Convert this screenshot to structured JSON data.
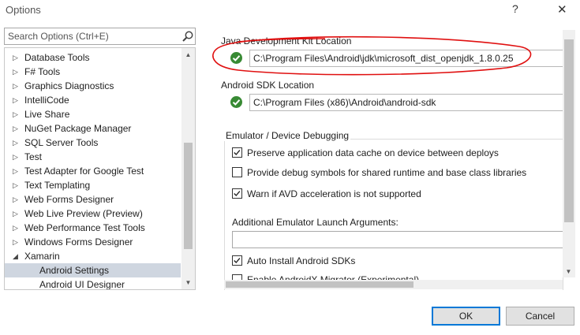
{
  "window": {
    "title": "Options",
    "help": "?",
    "close": "✕"
  },
  "search": {
    "placeholder": "Search Options (Ctrl+E)"
  },
  "tree": {
    "items": [
      {
        "label": "Database Tools",
        "expanded": false
      },
      {
        "label": "F# Tools",
        "expanded": false
      },
      {
        "label": "Graphics Diagnostics",
        "expanded": false
      },
      {
        "label": "IntelliCode",
        "expanded": false
      },
      {
        "label": "Live Share",
        "expanded": false
      },
      {
        "label": "NuGet Package Manager",
        "expanded": false
      },
      {
        "label": "SQL Server Tools",
        "expanded": false
      },
      {
        "label": "Test",
        "expanded": false
      },
      {
        "label": "Test Adapter for Google Test",
        "expanded": false
      },
      {
        "label": "Text Templating",
        "expanded": false
      },
      {
        "label": "Web Forms Designer",
        "expanded": false
      },
      {
        "label": "Web Live Preview (Preview)",
        "expanded": false
      },
      {
        "label": "Web Performance Test Tools",
        "expanded": false
      },
      {
        "label": "Windows Forms Designer",
        "expanded": false
      },
      {
        "label": "Xamarin",
        "expanded": true
      },
      {
        "label": "Android Settings",
        "child": true,
        "selected": true
      },
      {
        "label": "Android UI Designer",
        "child": true
      }
    ]
  },
  "settings": {
    "jdk": {
      "label": "Java Development Kit Location",
      "path": "C:\\Program Files\\Android\\jdk\\microsoft_dist_openjdk_1.8.0.25"
    },
    "sdk": {
      "label": "Android SDK Location",
      "path": "C:\\Program Files (x86)\\Android\\android-sdk"
    },
    "emulator": {
      "title": "Emulator / Device Debugging",
      "options": [
        {
          "label": "Preserve application data cache on device between deploys",
          "checked": true
        },
        {
          "label": "Provide debug symbols for shared runtime and base class libraries",
          "checked": false
        },
        {
          "label": "Warn if AVD acceleration is not supported",
          "checked": true
        }
      ],
      "args_label": "Additional Emulator Launch Arguments:",
      "args_value": ""
    },
    "auto_install": {
      "label": "Auto Install Android SDKs",
      "checked": true
    },
    "partial_next": {
      "label": "Enable AndroidX Migrator (Experimental)",
      "checked": false
    }
  },
  "buttons": {
    "ok": "OK",
    "cancel": "Cancel"
  },
  "colors": {
    "accent": "#0078d7",
    "valid": "#388a34",
    "annotation": "#e01010",
    "selected_row": "#cfd6e0"
  }
}
